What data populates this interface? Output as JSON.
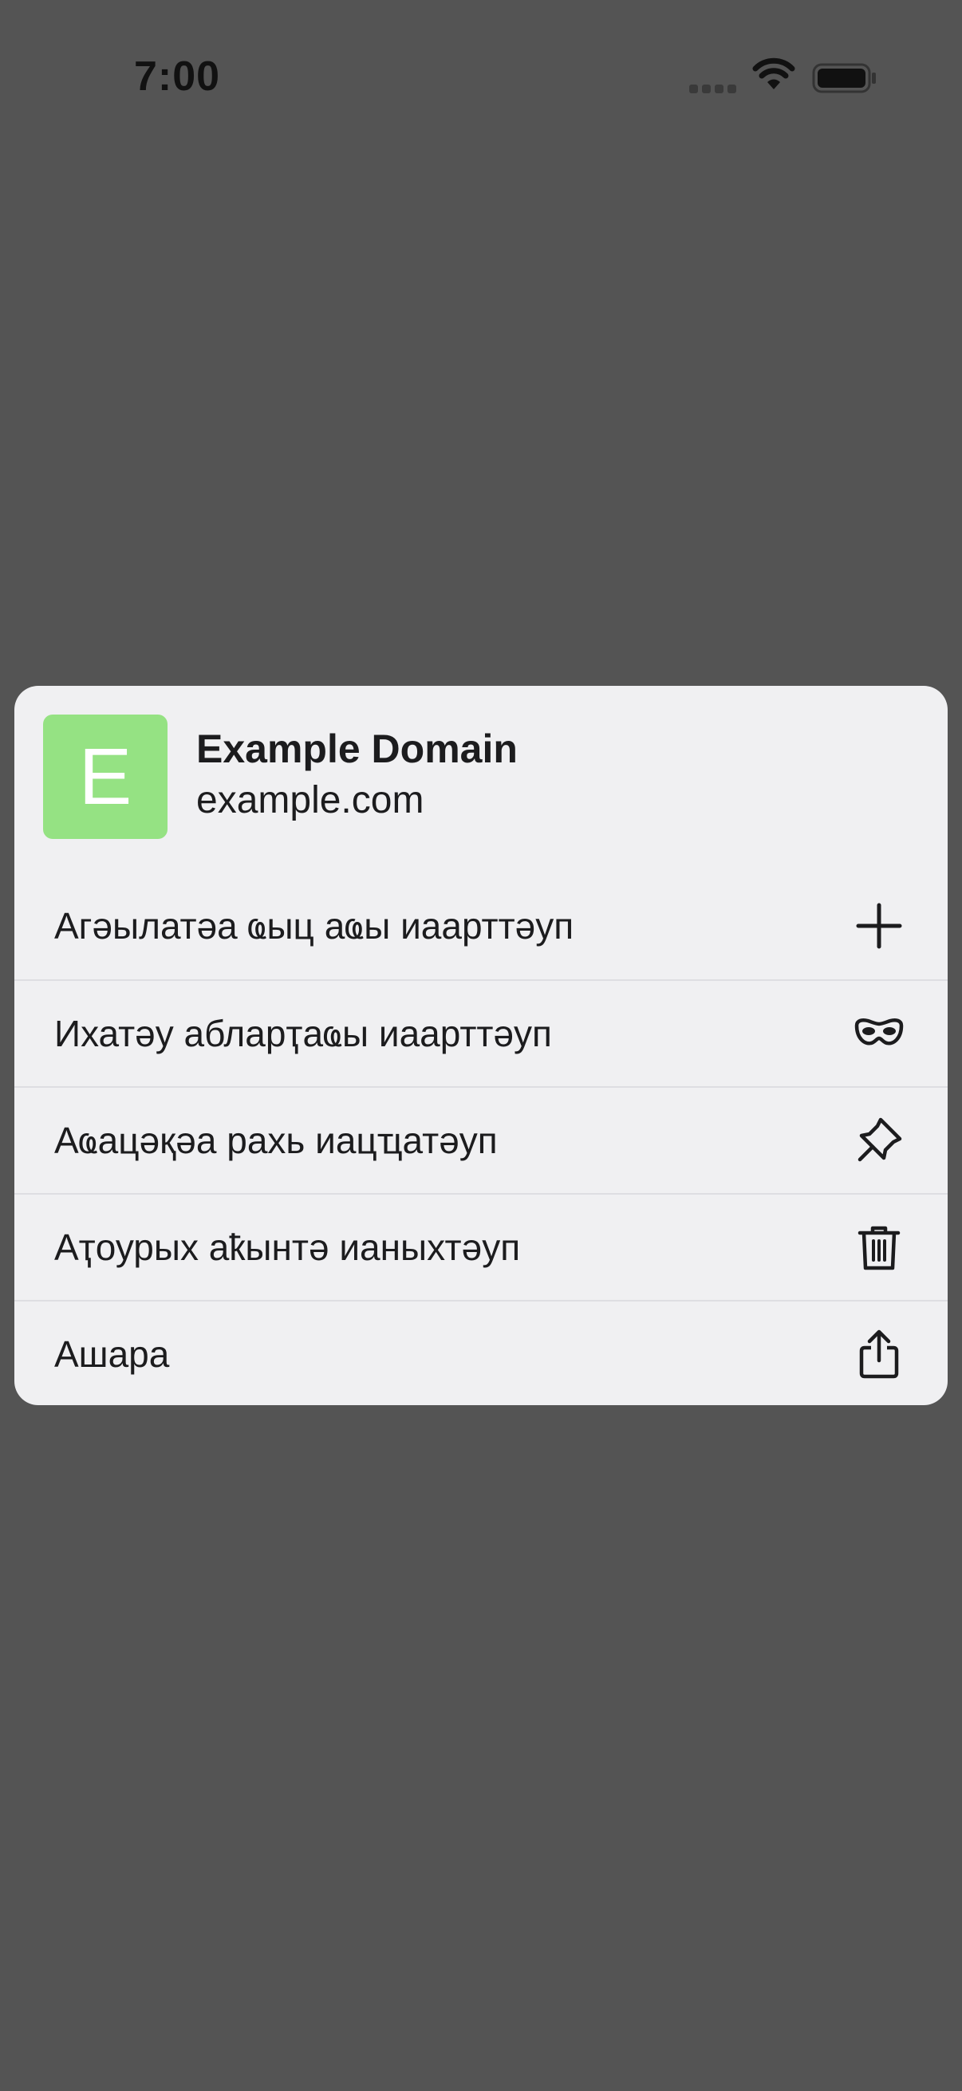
{
  "status_bar": {
    "time": "7:00"
  },
  "sheet": {
    "favicon_letter": "E",
    "favicon_color": "#95e283",
    "site_title": "Example Domain",
    "site_url": "example.com",
    "items": [
      {
        "label": "Агәылатәа ҩыц аҩы иаарттәуп",
        "icon": "plus-icon"
      },
      {
        "label": "Ихатәу абларҭаҩы иаарттәуп",
        "icon": "mask-icon"
      },
      {
        "label": "Аҩацәқәа рахь иацҵатәуп",
        "icon": "pin-icon"
      },
      {
        "label": "Аҭоурых аҟынтә ианыхтәуп",
        "icon": "trash-icon"
      },
      {
        "label": "Ашара",
        "icon": "share-icon"
      }
    ]
  },
  "colors": {
    "backdrop": "#545454",
    "sheet_background": "#f0f0f2",
    "text": "#1c1c1e"
  }
}
